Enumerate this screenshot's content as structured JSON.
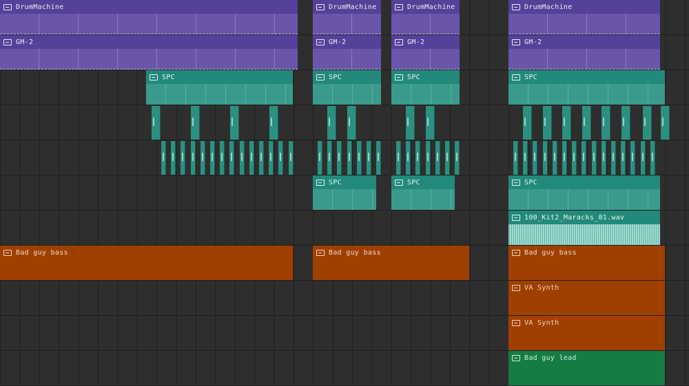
{
  "tracks": [
    {
      "name": "DrumMachine",
      "color": "#55409a"
    },
    {
      "name": "GM-2",
      "color": "#55409a"
    },
    {
      "name": "SPC",
      "color": "#23897a"
    },
    {
      "name": "",
      "color": "#23897a"
    },
    {
      "name": "",
      "color": "#23897a"
    },
    {
      "name": "SPC",
      "color": "#23897a"
    },
    {
      "name": "100_Kit2_Maracks",
      "color": "#23897a"
    },
    {
      "name": "Bad guy bass",
      "color": "#a04000"
    },
    {
      "name": "VA Synth",
      "color": "#a04000"
    },
    {
      "name": "VA Synth",
      "color": "#a04000"
    },
    {
      "name": "Bad guy lead",
      "color": "#167c44"
    }
  ],
  "clip_labels": {
    "drum": "DrumMachine",
    "gm": "GM-2",
    "spc": "SPC",
    "wav": "100_Kit2_Maracks_01.wav",
    "bass": "Bad guy bass",
    "va": "VA Synth",
    "lead": "Bad guy lead"
  },
  "icons": {
    "note_clip": "note-clip-icon",
    "audio_clip": "waveform-icon"
  }
}
